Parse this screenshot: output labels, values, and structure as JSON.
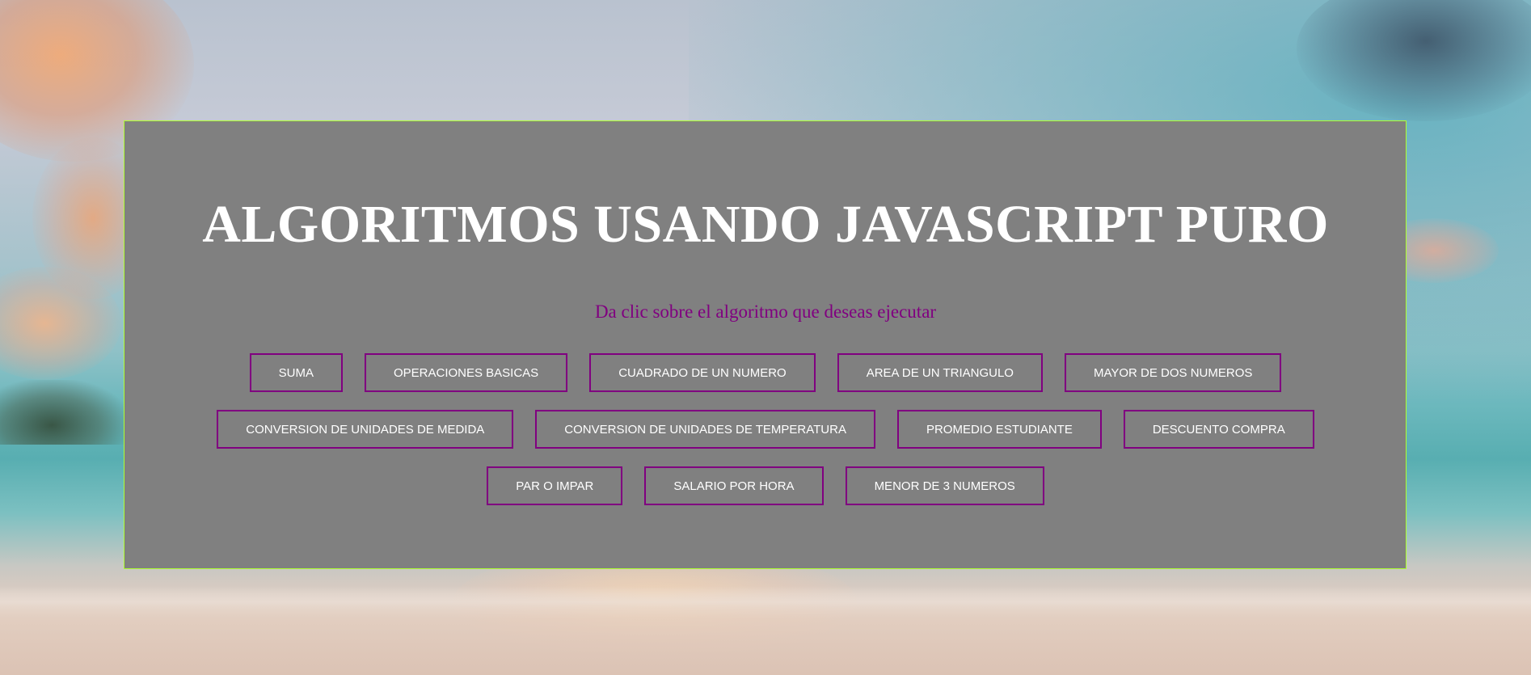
{
  "page": {
    "title": "ALGORITMOS USANDO JAVASCRIPT PURO",
    "subtitle": "Da clic sobre el algoritmo que deseas ejecutar"
  },
  "colors": {
    "panel_background": "#808080",
    "panel_border": "#adff2f",
    "title_text": "#ffffff",
    "subtitle_text": "#800080",
    "button_border": "#800080",
    "button_text": "#ffffff"
  },
  "algorithms": {
    "row1": [
      {
        "label": "SUMA"
      },
      {
        "label": "OPERACIONES BASICAS"
      },
      {
        "label": "CUADRADO DE UN NUMERO"
      },
      {
        "label": "AREA DE UN TRIANGULO"
      },
      {
        "label": "MAYOR DE DOS NUMEROS"
      }
    ],
    "row2": [
      {
        "label": "CONVERSION DE UNIDADES DE MEDIDA"
      },
      {
        "label": "CONVERSION DE UNIDADES DE TEMPERATURA"
      },
      {
        "label": "PROMEDIO ESTUDIANTE"
      },
      {
        "label": "DESCUENTO COMPRA"
      }
    ],
    "row3": [
      {
        "label": "PAR O IMPAR"
      },
      {
        "label": "SALARIO POR HORA"
      },
      {
        "label": "MENOR DE 3 NUMEROS"
      }
    ]
  }
}
